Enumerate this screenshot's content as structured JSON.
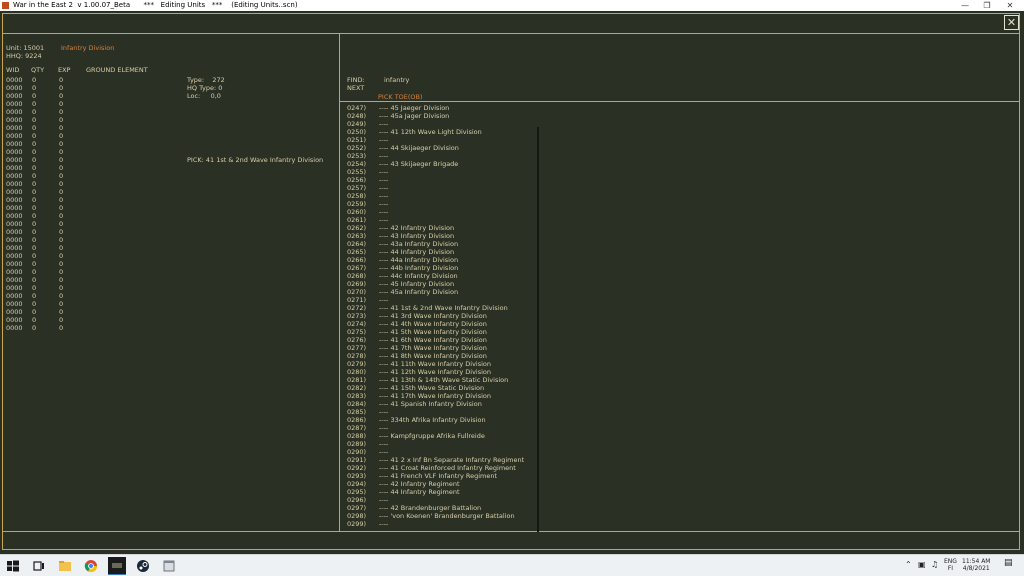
{
  "window": {
    "title": "War in the East 2  v 1.00.07_Beta      ***   Editing Units   ***    (Editing Units..scn)"
  },
  "unit_info": {
    "unit_label": "Unit: 15001",
    "unit_name": "Infantry Division",
    "hhq": "HHQ: 9224"
  },
  "table": {
    "headers": {
      "wid": "WID",
      "qty": "QTY",
      "exp": "EXP",
      "ground": "GROUND ELEMENT"
    },
    "wid_values": [
      "0000",
      "0000",
      "0000",
      "0000",
      "0000",
      "0000",
      "0000",
      "0000",
      "0000",
      "0000",
      "0000",
      "0000",
      "0000",
      "0000",
      "0000",
      "0000",
      "0000",
      "0000",
      "0000",
      "0000",
      "0000",
      "0000",
      "0000",
      "0000",
      "0000",
      "0000",
      "0000",
      "0000",
      "0000",
      "0000",
      "0000",
      "0000"
    ],
    "qty_values": [
      "0",
      "0",
      "0",
      "0",
      "0",
      "0",
      "0",
      "0",
      "0",
      "0",
      "0",
      "0",
      "0",
      "0",
      "0",
      "0",
      "0",
      "0",
      "0",
      "0",
      "0",
      "0",
      "0",
      "0",
      "0",
      "0",
      "0",
      "0",
      "0",
      "0",
      "0",
      "0"
    ],
    "exp_values": [
      "0",
      "0",
      "0",
      "0",
      "0",
      "0",
      "0",
      "0",
      "0",
      "0",
      "0",
      "0",
      "0",
      "0",
      "0",
      "0",
      "0",
      "0",
      "0",
      "0",
      "0",
      "0",
      "0",
      "0",
      "0",
      "0",
      "0",
      "0",
      "0",
      "0",
      "0",
      "0"
    ]
  },
  "type_info": {
    "type": "Type:    272",
    "hq_type": "HQ Type: 0",
    "loc": "Loc:     0,0",
    "pick": "PICK: 41 1st & 2nd Wave Infantry Division"
  },
  "search": {
    "find_label": "FIND:",
    "find_value": "infantry",
    "next_label": "NEXT",
    "pick_toe": "PICK TOE(OB)"
  },
  "toe_list": {
    "codes": [
      "0247)",
      "0248)",
      "0249)",
      "0250)",
      "0251)",
      "0252)",
      "0253)",
      "0254)",
      "0255)",
      "0256)",
      "0257)",
      "0258)",
      "0259)",
      "0260)",
      "0261)",
      "0262)",
      "0263)",
      "0264)",
      "0265)",
      "0266)",
      "0267)",
      "0268)",
      "0269)",
      "0270)",
      "0271)",
      "0272)",
      "0273)",
      "0274)",
      "0275)",
      "0276)",
      "0277)",
      "0278)",
      "0279)",
      "0280)",
      "0281)",
      "0282)",
      "0283)",
      "0284)",
      "0285)",
      "0286)",
      "0287)",
      "0288)",
      "0289)",
      "0290)",
      "0291)",
      "0292)",
      "0293)",
      "0294)",
      "0295)",
      "0296)",
      "0297)",
      "0298)",
      "0299)"
    ],
    "names": [
      "---- 45 Jaeger Division",
      "---- 45a Jager Division",
      "----",
      "---- 41 12th Wave Light Division",
      "----",
      "---- 44 Skijaeger Division",
      "----",
      "---- 43 Skijaeger Brigade",
      "----",
      "----",
      "----",
      "----",
      "----",
      "----",
      "----",
      "---- 42 Infantry Division",
      "---- 43 Infantry Division",
      "---- 43a Infantry Division",
      "---- 44 Infantry Division",
      "---- 44a Infantry Division",
      "---- 44b Infantry Division",
      "---- 44c Infantry Division",
      "---- 45 Infantry Division",
      "---- 45a Infantry Division",
      "----",
      "---- 41 1st & 2nd Wave Infantry Division",
      "---- 41 3rd Wave Infantry Division",
      "---- 41 4th Wave Infantry Division",
      "---- 41 5th Wave Infantry Division",
      "---- 41 6th Wave Infantry Division",
      "---- 41 7th Wave Infantry Division",
      "---- 41 8th Wave Infantry Division",
      "---- 41 11th Wave Infantry Division",
      "---- 41 12th Wave Infantry Division",
      "---- 41 13th & 14th Wave Static Division",
      "---- 41 15th Wave Static Division",
      "---- 41 17th Wave Infantry Division",
      "---- 41 Spanish Infantry Division",
      "----",
      "---- 334th Afrika Infantry Division",
      "----",
      "---- Kampfgruppe Afrika Fullreide",
      "----",
      "----",
      "---- 41 2 x Inf Bn Separate Infantry Regiment",
      "---- 41 Croat Reinforced Infantry Regiment",
      "---- 41 French VLF Infantry Regiment",
      "---- 42 Infantry Regiment",
      "---- 44 Infantry Regiment",
      "----",
      "---- 42 Brandenburger Battalion",
      "---- 'von Koenen' Brandenburger Battalion",
      "----"
    ]
  },
  "taskbar": {
    "lang": "ENG",
    "region": "FI",
    "time": "11:54 AM",
    "date": "4/8/2021"
  }
}
